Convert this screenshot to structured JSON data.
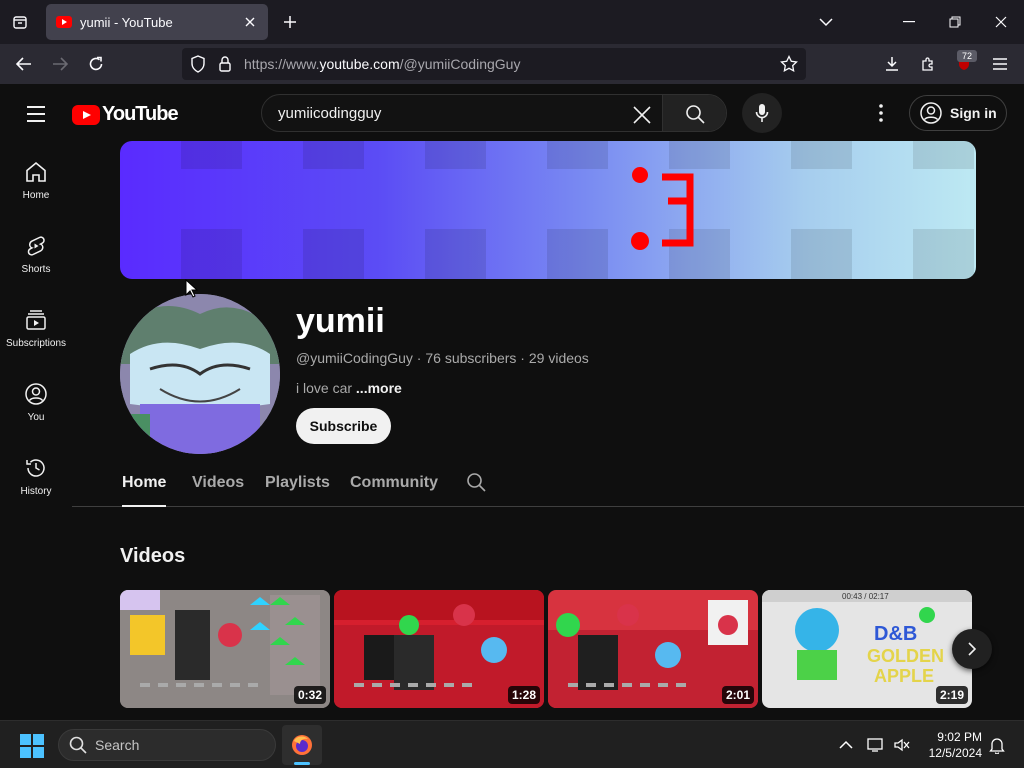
{
  "browser": {
    "tab_title": "yumii - YouTube",
    "url_prefix": "https://www.",
    "url_domain": "youtube.com",
    "url_path": "/@yumiiCodingGuy",
    "extension_badge": "72"
  },
  "yt_header": {
    "logo_text": "YouTube",
    "search_value": "yumiicodingguy",
    "signin_label": "Sign in"
  },
  "sidebar": {
    "items": [
      {
        "label": "Home",
        "icon": "home-icon"
      },
      {
        "label": "Shorts",
        "icon": "shorts-icon"
      },
      {
        "label": "Subscriptions",
        "icon": "subscriptions-icon"
      },
      {
        "label": "You",
        "icon": "you-icon"
      },
      {
        "label": "History",
        "icon": "history-icon"
      }
    ]
  },
  "channel": {
    "banner_text": ":3",
    "name": "yumii",
    "handle": "@yumiiCodingGuy",
    "subscribers": "76 subscribers",
    "videos_count": "29 videos",
    "description": "i love car ",
    "more_label": "...more",
    "subscribe_label": "Subscribe",
    "tabs": [
      "Home",
      "Videos",
      "Playlists",
      "Community"
    ],
    "active_tab": "Home"
  },
  "section": {
    "title": "Videos",
    "videos": [
      {
        "duration": "0:32"
      },
      {
        "duration": "1:28"
      },
      {
        "duration": "2:01"
      },
      {
        "duration": "2:19",
        "overlay_text": "00:43 / 02:17",
        "logo_text": "D&B GOLDEN APPLE"
      }
    ]
  },
  "taskbar": {
    "search_label": "Search",
    "time": "9:02 PM",
    "date": "12/5/2024"
  },
  "colors": {
    "brand_red": "#ff0000",
    "page_bg": "#0f0f0f",
    "accent_blue": "#4cc2ff"
  }
}
